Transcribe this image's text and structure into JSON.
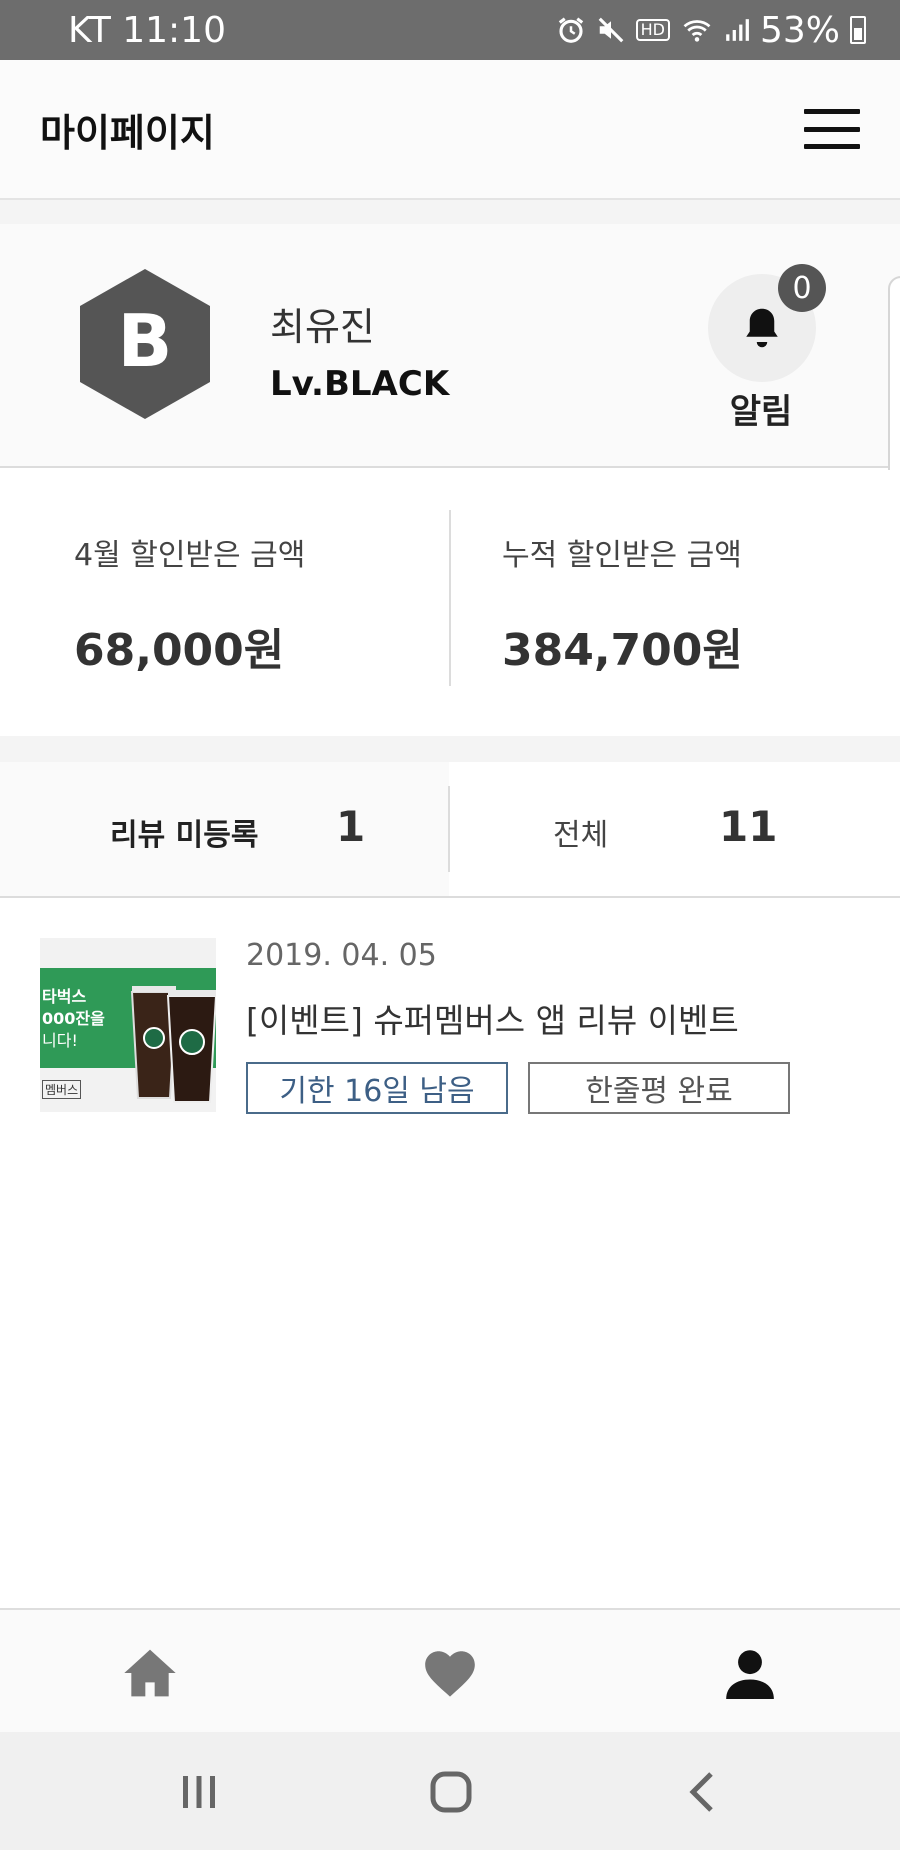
{
  "status_bar": {
    "carrier_time": "KT 11:10",
    "battery": "53%",
    "hd_label": "HD"
  },
  "header": {
    "title": "마이페이지"
  },
  "profile": {
    "badge_letter": "B",
    "name": "최유진",
    "level": "Lv.BLACK",
    "notification_count": "0",
    "notification_label": "알림"
  },
  "stats": {
    "monthly_label": "4월 할인받은 금액",
    "monthly_value": "68,000원",
    "total_label": "누적 할인받은 금액",
    "total_value": "384,700원"
  },
  "review_tabs": {
    "unregistered_label": "리뷰 미등록",
    "unregistered_count": "1",
    "all_label": "전체",
    "all_count": "11"
  },
  "events": [
    {
      "thumb_line1": "타벅스",
      "thumb_line2": "000잔을",
      "thumb_line3": "니다!",
      "thumb_logo": "멤버스",
      "date": "2019. 04. 05",
      "title": "[이벤트] 슈퍼멤버스 앱 리뷰 이벤트",
      "deadline_tag": "기한 16일 남음",
      "status_tag": "한줄평 완료"
    }
  ],
  "colors": {
    "status_bar": "#6d6d6d",
    "accent_blue": "#3d5f85",
    "thumb_green": "#2f9a57",
    "dark_icon": "#111111",
    "muted_icon": "#777777"
  },
  "icons": {
    "menu": "hamburger-menu-icon",
    "bell": "bell-icon",
    "home": "home-icon",
    "favorites": "heart-icon",
    "profile": "person-icon",
    "recents": "recent-apps-icon",
    "home_sys": "system-home-icon",
    "back": "back-chevron-icon"
  }
}
